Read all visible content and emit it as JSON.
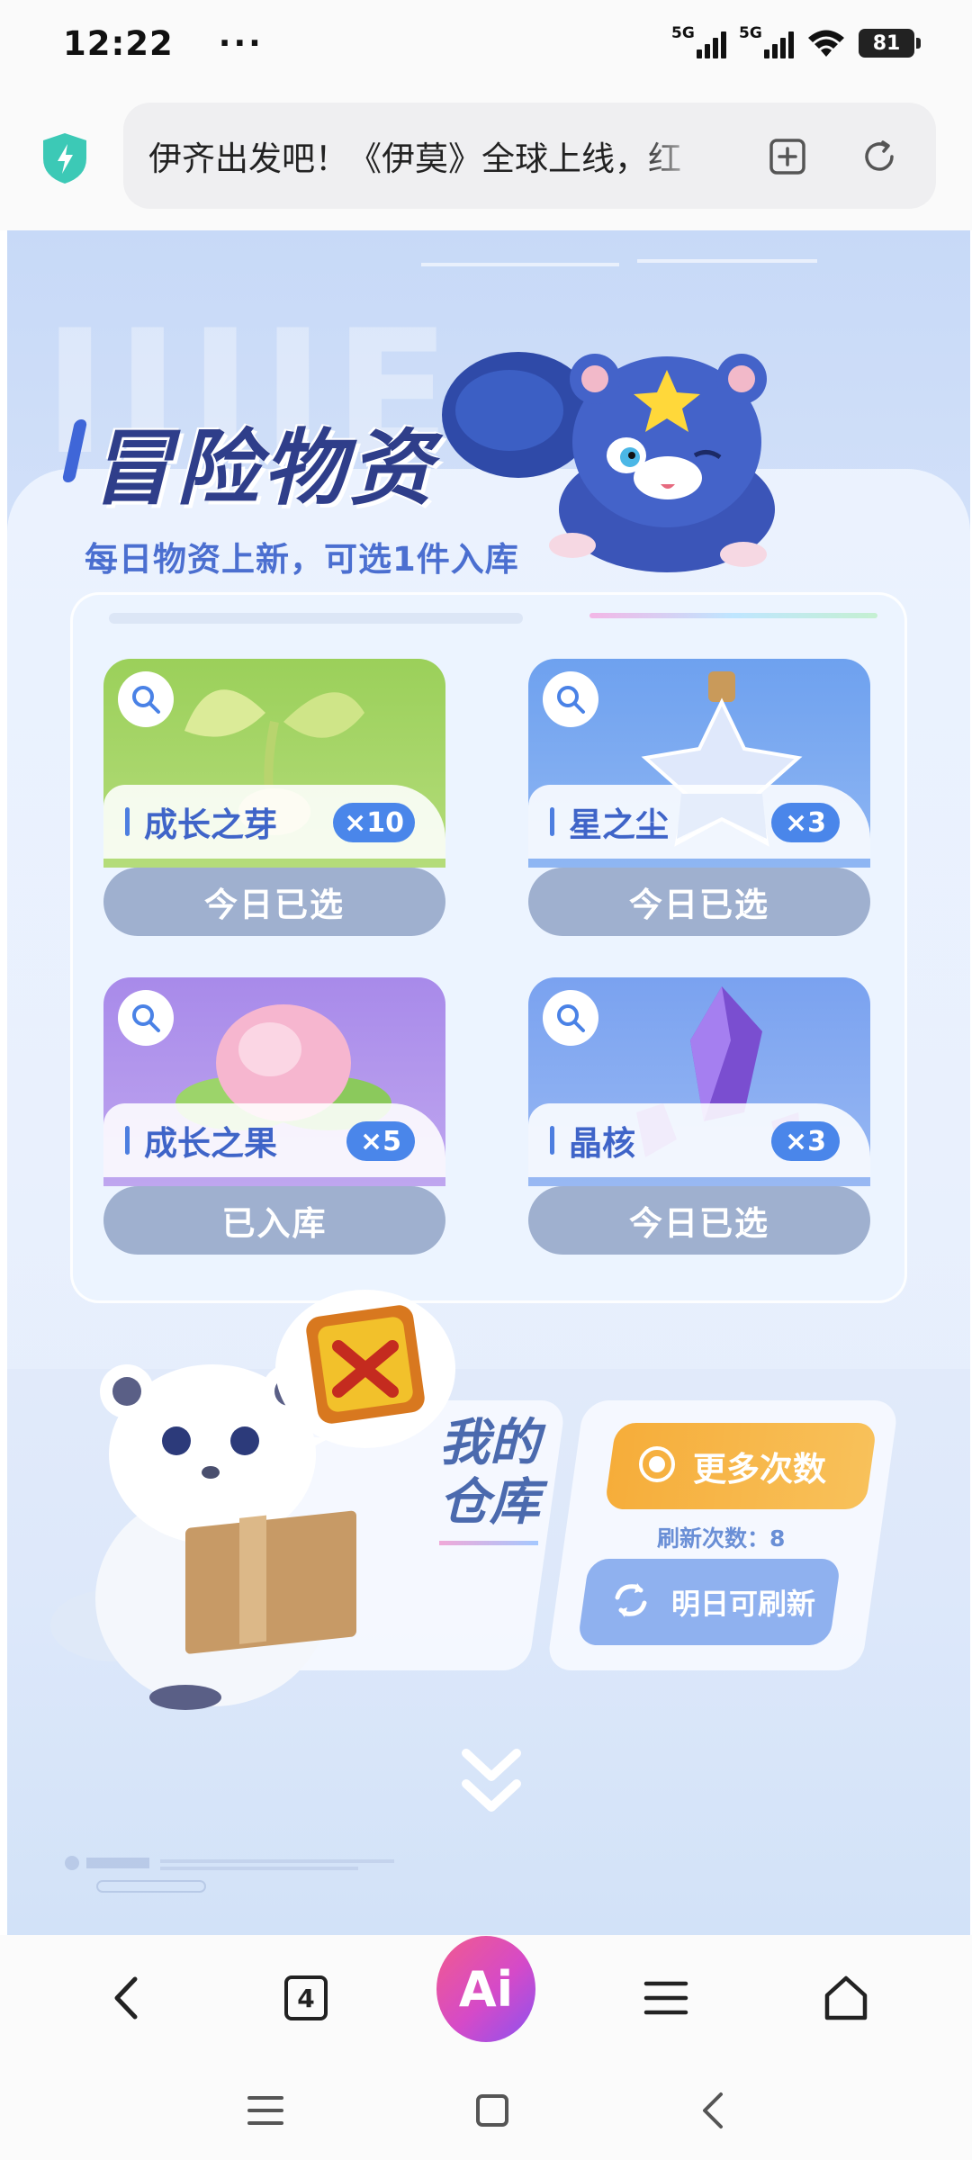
{
  "status_bar": {
    "time": "12:22",
    "dots": "···",
    "signal1_label": "5G",
    "signal2_label": "5G",
    "battery": "81"
  },
  "address_bar": {
    "url_text": "伊齐出发吧！《伊莫》全球上线，红",
    "shield_color": "#3cc9b6"
  },
  "page": {
    "bg_text": "IIIIE",
    "title": "冒险物资",
    "subtitle": "每日物资上新，可选1件入库",
    "items": [
      {
        "name": "成长之芽",
        "qty": "×10",
        "button": "今日已选",
        "theme": "#9acb5a"
      },
      {
        "name": "星之尘",
        "qty": "×3",
        "button": "今日已选",
        "theme": "#6da2ee"
      },
      {
        "name": "成长之果",
        "qty": "×5",
        "button": "已入库",
        "theme": "#a58ee8"
      },
      {
        "name": "晶核",
        "qty": "×3",
        "button": "今日已选",
        "theme": "#7fa6f0"
      }
    ],
    "warehouse_title_line1": "我的",
    "warehouse_title_line2": "仓库",
    "more_times_button": "更多次数",
    "refresh_count_label": "刷新次数：8",
    "refresh_button": "明日可刷新"
  },
  "toolbar": {
    "back_icon": "chevron-left-icon",
    "tab_count": "4",
    "ai_label": "Ai",
    "menu_icon": "menu-icon",
    "home_icon": "home-icon"
  },
  "system_nav": {
    "recents_icon": "menu-icon",
    "home_icon": "square-icon",
    "back_icon": "triangle-back-icon"
  }
}
